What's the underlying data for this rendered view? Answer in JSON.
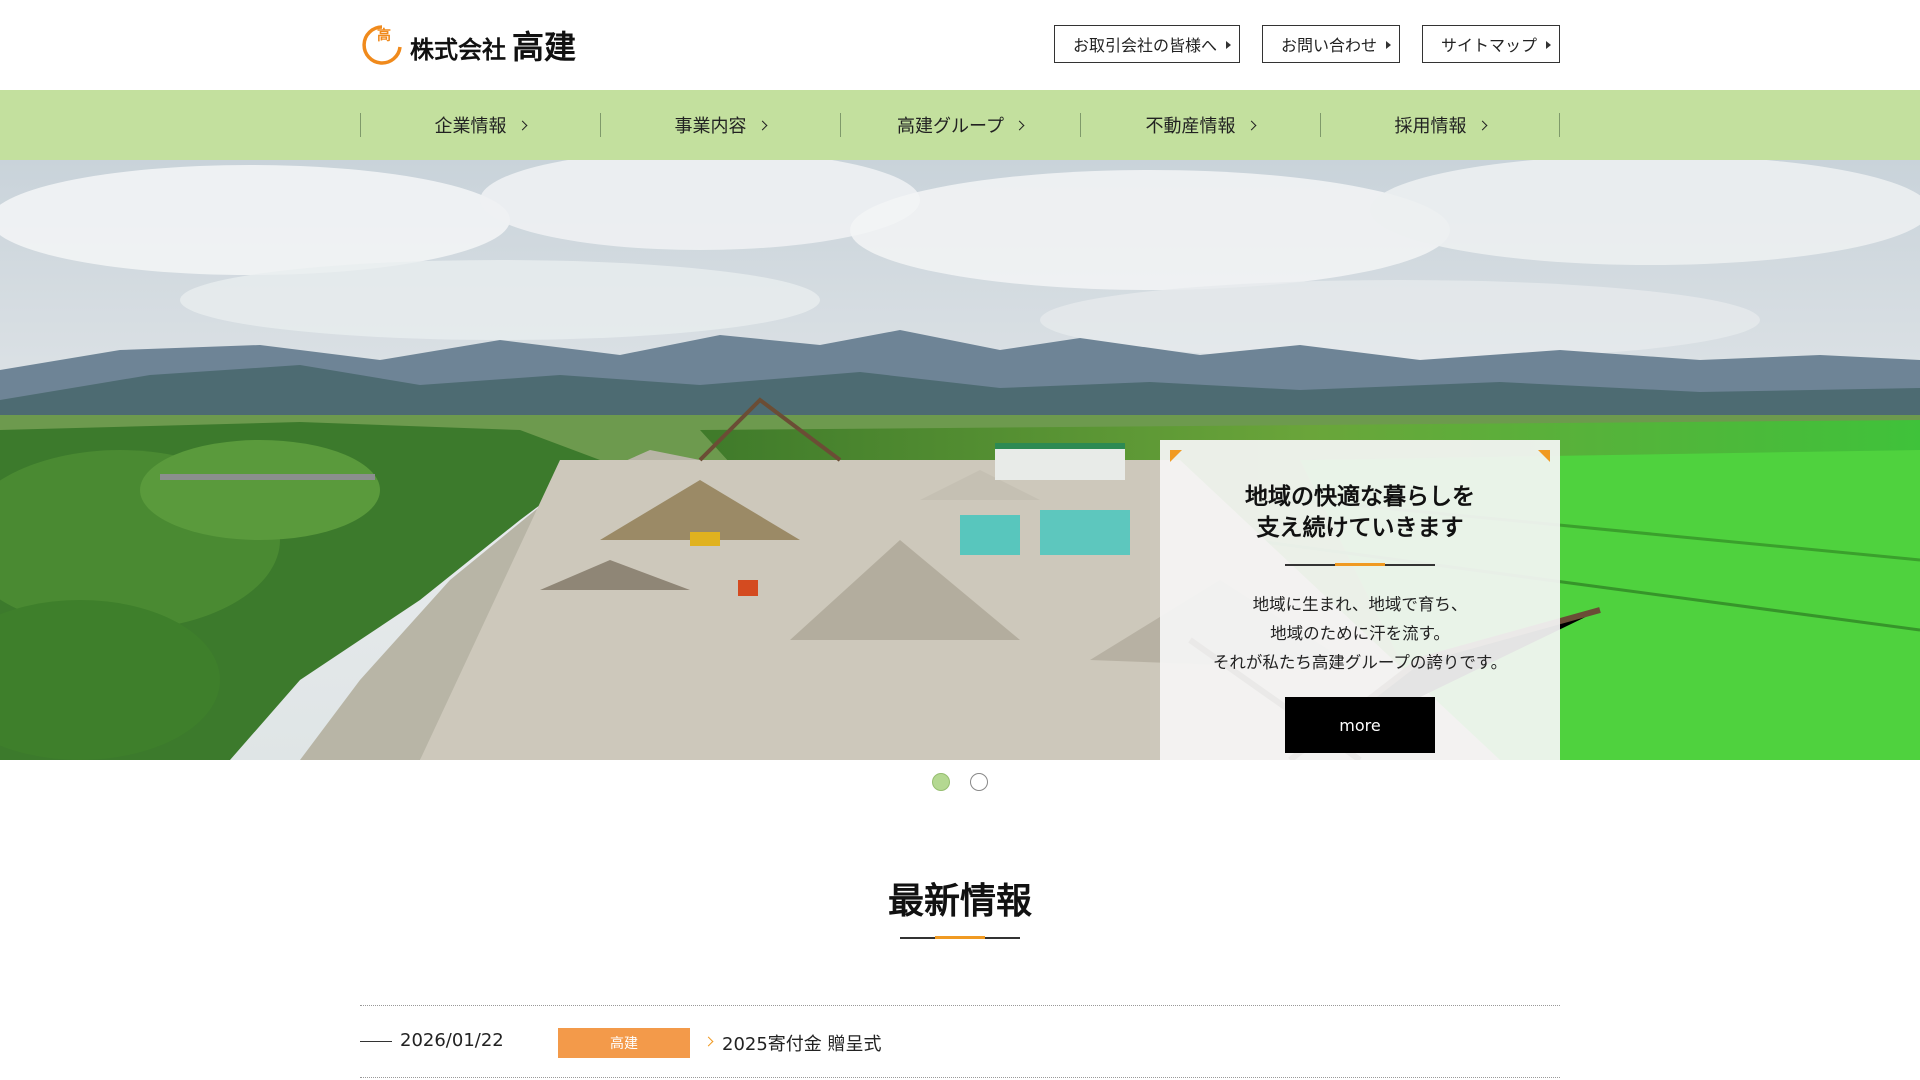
{
  "header": {
    "logo_mark_char": "高",
    "logo_kabu": "株式会社",
    "logo_name": "高建",
    "top_links": [
      {
        "label": "お取引会社の皆様へ"
      },
      {
        "label": "お問い合わせ"
      },
      {
        "label": "サイトマップ"
      }
    ]
  },
  "nav": {
    "items": [
      {
        "label": "企業情報"
      },
      {
        "label": "事業内容"
      },
      {
        "label": "高建グループ"
      },
      {
        "label": "不動産情報"
      },
      {
        "label": "採用情報"
      }
    ]
  },
  "hero": {
    "card_title_line1": "地域の快適な暮らしを",
    "card_title_line2": "支え続けていきます",
    "body_lines": [
      "地域に生まれ、地域で育ち、",
      "地域のために汗を流す。",
      "それが私たち高建グループの誇りです。"
    ],
    "more_label": "more",
    "slides_total": 2,
    "active_slide": 1
  },
  "news": {
    "title": "最新情報",
    "items": [
      {
        "date": "2026/01/22",
        "tag": "高建",
        "text": "2025寄付金 贈呈式"
      }
    ]
  },
  "colors": {
    "nav_bg": "#c3e09e",
    "accent_orange": "#f09a22",
    "tag_orange": "#f39a4a",
    "dot_active": "#b4d891"
  }
}
